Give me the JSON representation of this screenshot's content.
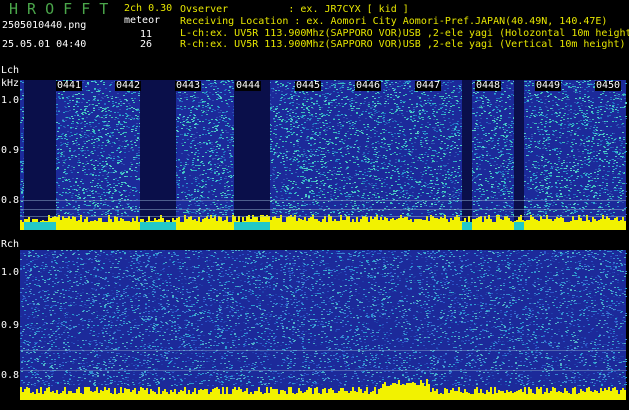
{
  "header": {
    "title": "H R O F F T",
    "version": "2ch 0.30",
    "mode": "meteor",
    "file_name": "2505010440.png",
    "date_time": "25.05.01 04:40",
    "count_l": "11",
    "count_r": "26"
  },
  "station": {
    "observer": "Ovserver          : ex. JR7CYX [ kid ]",
    "location": "Receiving Location : ex. Aomori City Aomori-Pref.JAPAN(40.49N, 140.47E)",
    "lch": "L-ch:ex. UV5R 113.900Mhz(SAPPORO VOR)USB ,2-ele yagi (Holozontal 10m height)",
    "rch": "R-ch:ex. UV5R 113.900Mhz(SAPPORO VOR)USB ,2-ele yagi (Vertical 10m height)"
  },
  "lch_panel": {
    "label": "Lch",
    "unit": "kHz",
    "ticks": [
      "1.0",
      "0.9",
      "0.8"
    ],
    "time_labels": [
      "0441",
      "0442",
      "0443",
      "0444",
      "0445",
      "0446",
      "0447",
      "0448",
      "0449",
      "0450"
    ]
  },
  "rch_panel": {
    "label": "Rch",
    "ticks": [
      "1.0",
      "0.9",
      "0.8"
    ]
  },
  "colors": {
    "background": "#000000",
    "spectrogram_base": "#1c2a9a",
    "noise_cyan": "#22c8c8",
    "signal_yellow": "#f2f200",
    "dropout_dark": "#0a0f4a",
    "title_green": "#4aa64a",
    "info_yellow": "#e6e600"
  }
}
